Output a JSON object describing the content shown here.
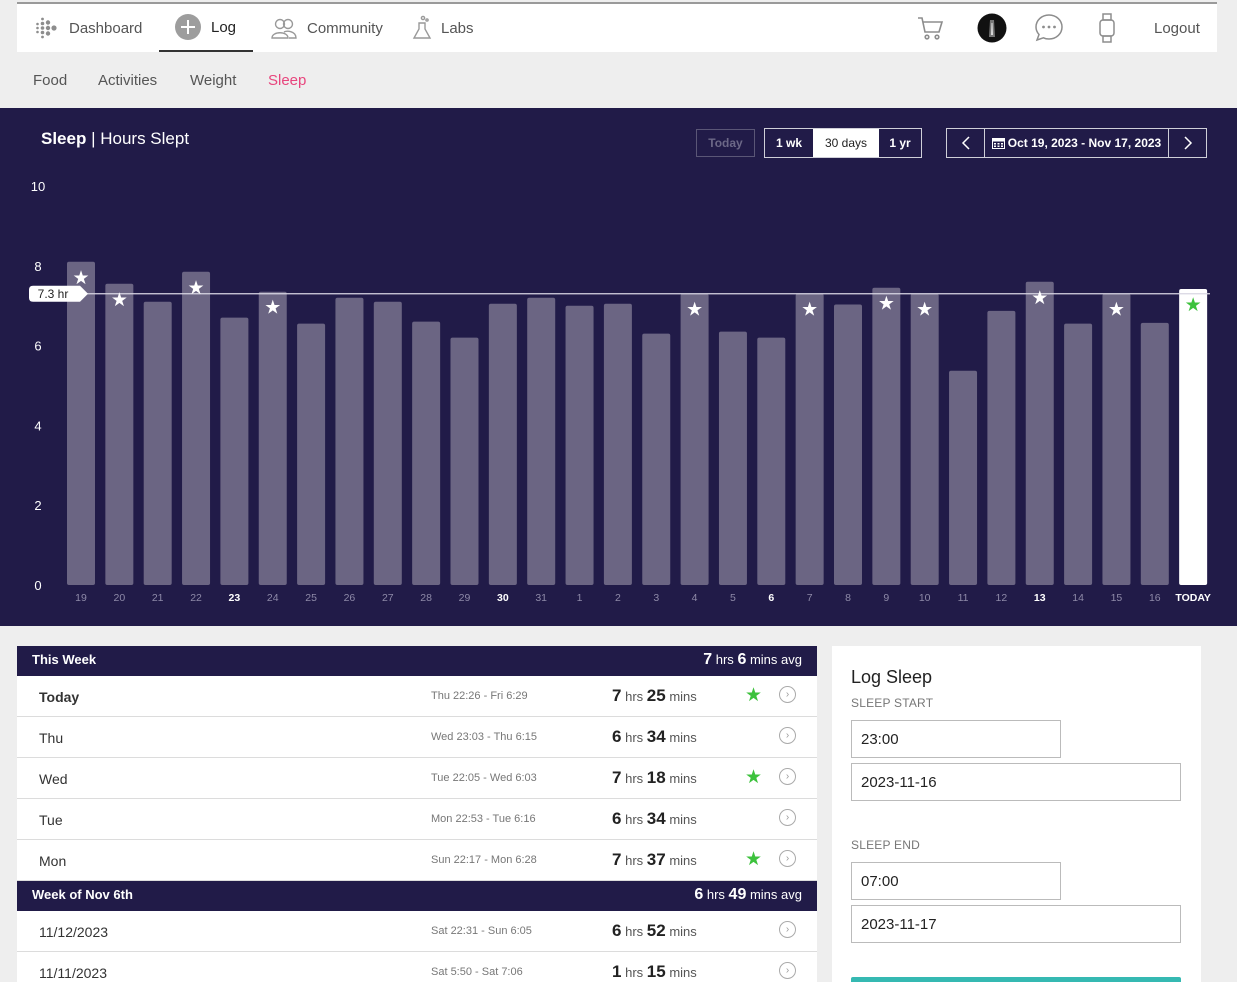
{
  "nav": {
    "dashboard": "Dashboard",
    "log": "Log",
    "community": "Community",
    "labs": "Labs",
    "logout": "Logout"
  },
  "subnav": {
    "food": "Food",
    "activities": "Activities",
    "weight": "Weight",
    "sleep": "Sleep"
  },
  "colors": {
    "panel": "#211b48",
    "bar": "#6b6583",
    "today_bar": "#ffffff",
    "accent_pink": "#e8457d",
    "goal_star": "#3dc23d",
    "button_teal": "#35b9b2"
  },
  "panel": {
    "title_bold": "Sleep",
    "title_rest": " | Hours Slept",
    "today_btn": "Today",
    "range_1wk": "1 wk",
    "range_30days": "30 days",
    "range_1yr": "1 yr",
    "date_range": "Oct 19, 2023 - Nov 17, 2023"
  },
  "chart_data": {
    "type": "bar",
    "title": "Sleep | Hours Slept",
    "ylim": [
      0,
      10
    ],
    "yticks": [
      0,
      2,
      4,
      6,
      8,
      10
    ],
    "goal_line": 7.3,
    "goal_label": "7.3 hr",
    "categories": [
      "19",
      "20",
      "21",
      "22",
      "23",
      "24",
      "25",
      "26",
      "27",
      "28",
      "29",
      "30",
      "31",
      "1",
      "2",
      "3",
      "4",
      "5",
      "6",
      "7",
      "8",
      "9",
      "10",
      "11",
      "12",
      "13",
      "14",
      "15",
      "16",
      "TODAY"
    ],
    "bold_categories": [
      "23",
      "30",
      "6",
      "13",
      "TODAY"
    ],
    "values": [
      8.1,
      7.55,
      7.1,
      7.85,
      6.7,
      7.35,
      6.55,
      7.2,
      7.1,
      6.6,
      6.2,
      7.05,
      7.2,
      7.0,
      7.05,
      6.3,
      7.3,
      6.35,
      6.2,
      7.3,
      7.03,
      7.45,
      7.3,
      5.37,
      6.87,
      7.6,
      6.55,
      7.3,
      6.57,
      7.42
    ],
    "stars": [
      true,
      true,
      false,
      true,
      false,
      true,
      false,
      false,
      false,
      false,
      false,
      false,
      false,
      false,
      false,
      false,
      true,
      false,
      false,
      true,
      false,
      true,
      true,
      false,
      false,
      true,
      false,
      true,
      false,
      true
    ],
    "grid": false
  },
  "this_week": {
    "title": "This Week",
    "avg_h": "7",
    "avg_m": "6",
    "avg_h_unit": "hrs",
    "avg_m_unit": "mins avg",
    "rows": [
      {
        "day": "Today",
        "range": "Thu 22:26 - Fri 6:29",
        "h": "7",
        "m": "25"
      },
      {
        "day": "Thu",
        "range": "Wed 23:03 - Thu 6:15",
        "h": "6",
        "m": "34"
      },
      {
        "day": "Wed",
        "range": "Tue 22:05 - Wed 6:03",
        "h": "7",
        "m": "18"
      },
      {
        "day": "Tue",
        "range": "Mon 22:53 - Tue 6:16",
        "h": "6",
        "m": "34"
      },
      {
        "day": "Mon",
        "range": "Sun 22:17 - Mon 6:28",
        "h": "7",
        "m": "37"
      }
    ]
  },
  "week_nov6": {
    "title": "Week of Nov 6th",
    "avg_h": "6",
    "avg_m": "49",
    "avg_h_unit": "hrs",
    "avg_m_unit": "mins avg",
    "rows": [
      {
        "day": "11/12/2023",
        "range": "Sat 22:31 - Sun 6:05",
        "h": "6",
        "m": "52"
      },
      {
        "day": "11/11/2023",
        "range": "Sat 5:50 - Sat 7:06",
        "h": "1",
        "m": "15"
      }
    ]
  },
  "units": {
    "hrs": "hrs",
    "mins": "mins"
  },
  "log_sleep": {
    "title": "Log Sleep",
    "start_label": "SLEEP START",
    "start_time": "23:00",
    "start_date": "2023-11-16",
    "end_label": "SLEEP END",
    "end_time": "07:00",
    "end_date": "2023-11-17"
  }
}
